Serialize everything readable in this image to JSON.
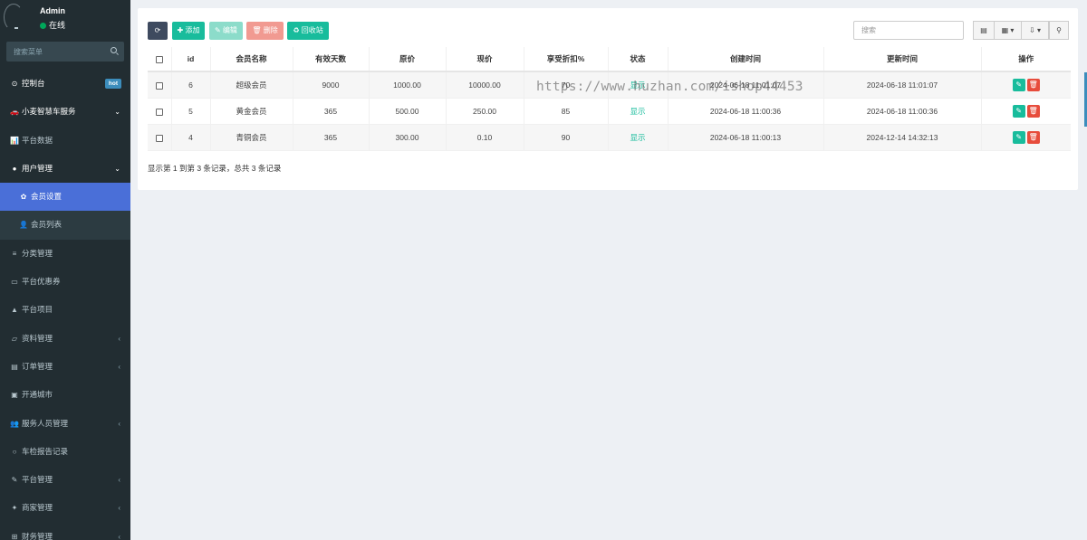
{
  "user": {
    "name": "Admin",
    "status": "在线"
  },
  "sidebar": {
    "search_placeholder": "搜索菜单",
    "items": [
      {
        "icon": "⊙",
        "label": "控制台",
        "badge": "hot"
      },
      {
        "icon": "🚗",
        "label": "小麦智慧车服务",
        "arrow": "⌄"
      },
      {
        "icon": "📊",
        "label": "平台数据"
      },
      {
        "icon": "●",
        "label": "用户管理",
        "arrow": "⌄"
      },
      {
        "icon": "✿",
        "label": "会员设置"
      },
      {
        "icon": "👤",
        "label": "会员列表"
      },
      {
        "icon": "≡",
        "label": "分类管理"
      },
      {
        "icon": "▭",
        "label": "平台优惠券"
      },
      {
        "icon": "▲",
        "label": "平台项目"
      },
      {
        "icon": "▱",
        "label": "资料管理",
        "arrow": "‹"
      },
      {
        "icon": "▤",
        "label": "订单管理",
        "arrow": "‹"
      },
      {
        "icon": "▣",
        "label": "开通城市"
      },
      {
        "icon": "👥",
        "label": "服务人员管理",
        "arrow": "‹"
      },
      {
        "icon": "○",
        "label": "车检报告记录"
      },
      {
        "icon": "✎",
        "label": "平台管理",
        "arrow": "‹"
      },
      {
        "icon": "✦",
        "label": "商家管理",
        "arrow": "‹"
      },
      {
        "icon": "⊞",
        "label": "财务管理",
        "arrow": "‹"
      }
    ]
  },
  "toolbar": {
    "refresh_icon": "⟳",
    "add": "✚ 添加",
    "edit": "✎ 编辑",
    "delete": "🗑 删除",
    "recycle": "♻ 回收站",
    "search_placeholder": "搜索",
    "columns_icon": "▦",
    "export_icon": "⇩"
  },
  "table": {
    "headers": [
      "id",
      "会员名称",
      "有效天数",
      "原价",
      "现价",
      "享受折扣%",
      "状态",
      "创建时间",
      "更新时间",
      "操作"
    ],
    "rows": [
      {
        "id": "6",
        "name": "超级会员",
        "days": "9000",
        "original": "1000.00",
        "current": "10000.00",
        "discount": "70",
        "status": "显示",
        "created": "2024-06-18 11:01:07",
        "updated": "2024-06-18 11:01:07"
      },
      {
        "id": "5",
        "name": "黄金会员",
        "days": "365",
        "original": "500.00",
        "current": "250.00",
        "discount": "85",
        "status": "显示",
        "created": "2024-06-18 11:00:36",
        "updated": "2024-06-18 11:00:36"
      },
      {
        "id": "4",
        "name": "青铜会员",
        "days": "365",
        "original": "300.00",
        "current": "0.10",
        "discount": "90",
        "status": "显示",
        "created": "2024-06-18 11:00:13",
        "updated": "2024-12-14 14:32:13"
      }
    ]
  },
  "footer": {
    "info": "显示第 1 到第 3 条记录，总共 3 条记录"
  },
  "watermark": "https://www.huzhan.com/ishop44453"
}
